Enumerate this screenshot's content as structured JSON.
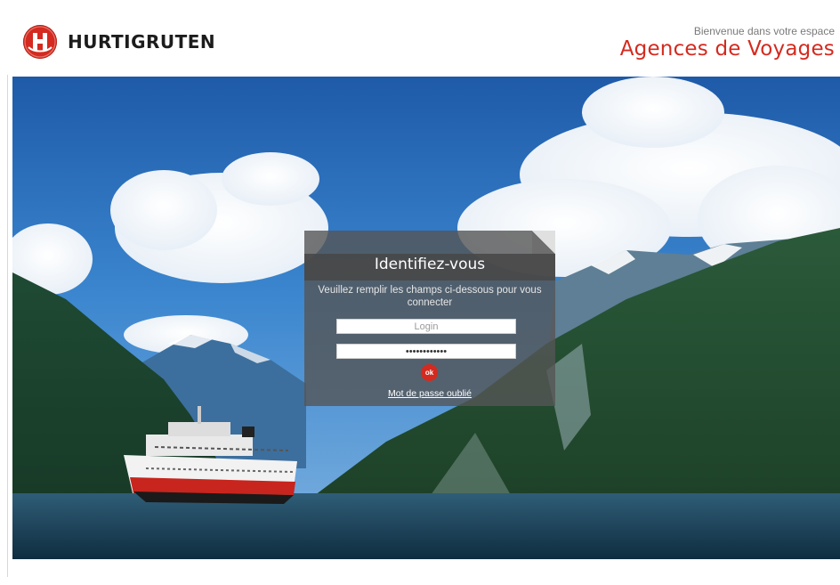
{
  "header": {
    "brand": "HURTIGRUTEN",
    "logo_letter": "H",
    "welcome_small": "Bienvenue dans votre espace",
    "welcome_title": "Agences de Voyages"
  },
  "hero": {
    "image": "fjord-landscape-with-ship"
  },
  "login": {
    "title": "Identifiez-vous",
    "instructions": "Veuillez remplir les champs ci-dessous pour vous connecter",
    "login_placeholder": "Login",
    "password_value": "••••••••••••",
    "ok_label": "ok",
    "forgot_password": "Mot de passe oublié"
  },
  "colors": {
    "brand_red": "#d42a1f",
    "panel": "#555555"
  }
}
